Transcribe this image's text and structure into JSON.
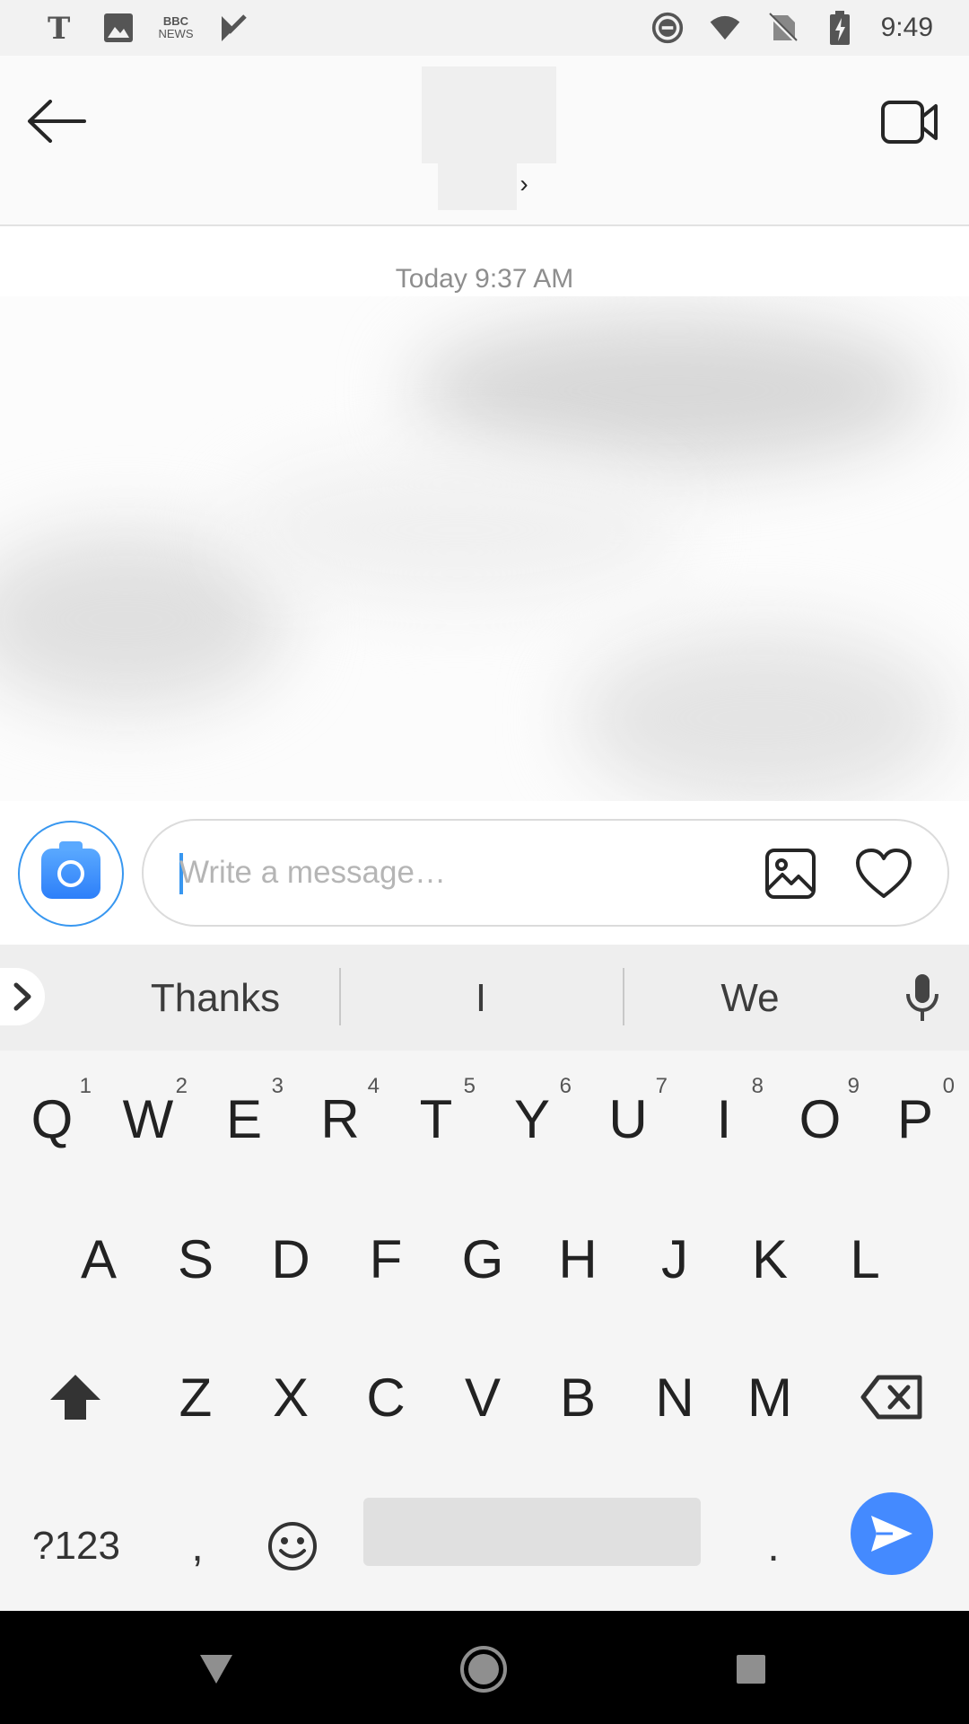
{
  "status_bar": {
    "time": "9:49",
    "bbc_line1": "BBC",
    "bbc_line2": "NEWS",
    "left_icons": [
      "nyt-icon",
      "image-icon",
      "bbc-news-icon",
      "play-store-icon"
    ],
    "right_icons": [
      "do-not-disturb-icon",
      "wifi-icon",
      "no-sim-icon",
      "battery-charging-icon"
    ]
  },
  "header": {
    "back_icon": "arrow-left-icon",
    "video_icon": "video-camera-icon",
    "chevron": "›"
  },
  "chat": {
    "timestamp": "Today 9:37 AM"
  },
  "composer": {
    "placeholder": "Write a message…",
    "value": "",
    "accent": "#3897f0"
  },
  "keyboard": {
    "suggestions": [
      "Thanks",
      "I",
      "We"
    ],
    "row1": [
      {
        "key": "Q",
        "hint": "1"
      },
      {
        "key": "W",
        "hint": "2"
      },
      {
        "key": "E",
        "hint": "3"
      },
      {
        "key": "R",
        "hint": "4"
      },
      {
        "key": "T",
        "hint": "5"
      },
      {
        "key": "Y",
        "hint": "6"
      },
      {
        "key": "U",
        "hint": "7"
      },
      {
        "key": "I",
        "hint": "8"
      },
      {
        "key": "O",
        "hint": "9"
      },
      {
        "key": "P",
        "hint": "0"
      }
    ],
    "row2": [
      "A",
      "S",
      "D",
      "F",
      "G",
      "H",
      "J",
      "K",
      "L"
    ],
    "row3": [
      "Z",
      "X",
      "C",
      "V",
      "B",
      "N",
      "M"
    ],
    "symbols_label": "?123",
    "comma_label": ",",
    "period_label": ".",
    "send_color": "#448aff"
  }
}
